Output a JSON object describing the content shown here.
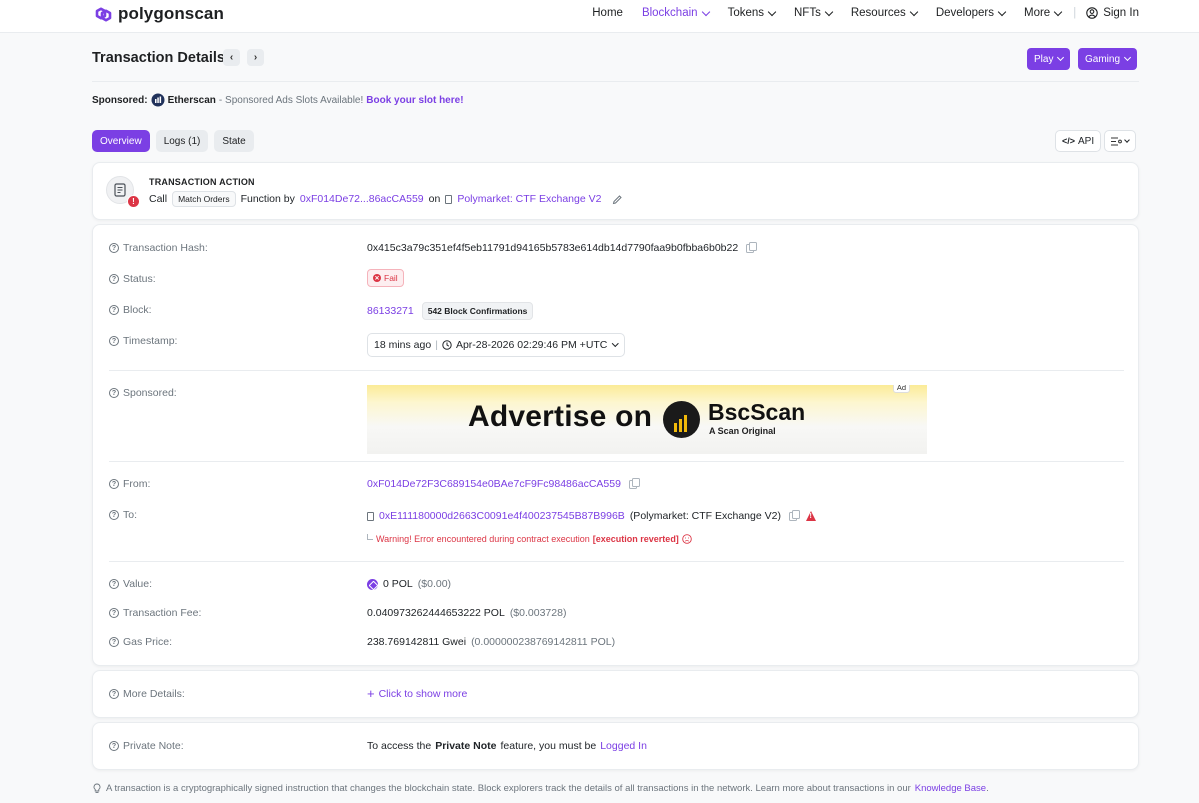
{
  "header": {
    "logo_text": "polygonscan",
    "nav": [
      {
        "label": "Home",
        "active": false,
        "dropdown": false
      },
      {
        "label": "Blockchain",
        "active": true,
        "dropdown": true
      },
      {
        "label": "Tokens",
        "active": false,
        "dropdown": true
      },
      {
        "label": "NFTs",
        "active": false,
        "dropdown": true
      },
      {
        "label": "Resources",
        "active": false,
        "dropdown": true
      },
      {
        "label": "Developers",
        "active": false,
        "dropdown": true
      },
      {
        "label": "More",
        "active": false,
        "dropdown": true
      }
    ],
    "sign_in": "Sign In"
  },
  "page": {
    "title": "Transaction Details",
    "play_label": "Play",
    "gaming_label": "Gaming"
  },
  "sponsor_line": {
    "label": "Sponsored:",
    "brand": "Etherscan",
    "text": "- Sponsored Ads Slots Available!",
    "link": "Book your slot here!"
  },
  "tabs": [
    {
      "label": "Overview",
      "active": true
    },
    {
      "label": "Logs (1)",
      "active": false
    },
    {
      "label": "State",
      "active": false
    }
  ],
  "tools": {
    "api_label": "API"
  },
  "action": {
    "title": "TRANSACTION ACTION",
    "call": "Call",
    "method": "Match Orders",
    "function_by": "Function by",
    "from_short": "0xF014De72...86acCA559",
    "on": "on",
    "contract": "Polymarket: CTF Exchange V2"
  },
  "details": {
    "tx_hash_label": "Transaction Hash:",
    "tx_hash": "0x415c3a79c351ef4f5eb11791d94165b5783e614db14d7790faa9b0fbba6b0b22",
    "status_label": "Status:",
    "status": "Fail",
    "block_label": "Block:",
    "block": "86133271",
    "confirmations": "542 Block Confirmations",
    "timestamp_label": "Timestamp:",
    "timestamp_ago": "18 mins ago",
    "timestamp_sep": "|",
    "timestamp": "Apr-28-2026 02:29:46 PM +UTC",
    "sponsored_label": "Sponsored:",
    "ad": {
      "tag": "Ad",
      "text": "Advertise on",
      "brand": "BscScan",
      "sub": "A Scan Original"
    },
    "from_label": "From:",
    "from": "0xF014De72F3C689154e0BAe7cF9Fc98486acCA559",
    "to_label": "To:",
    "to": "0xE111180000d2663C0091e4f400237545B87B996B",
    "to_name": "(Polymarket: CTF Exchange V2)",
    "warning": "Warning! Error encountered during contract execution",
    "warning_reason": "[execution reverted]",
    "value_label": "Value:",
    "value": "0 POL",
    "value_usd": "($0.00)",
    "fee_label": "Transaction Fee:",
    "fee": "0.040973262444653222 POL",
    "fee_usd": "($0.003728)",
    "gas_label": "Gas Price:",
    "gas": "238.769142811 Gwei",
    "gas_pol": "(0.000000238769142811 POL)"
  },
  "more": {
    "label": "More Details:",
    "link": "Click to show more"
  },
  "note": {
    "label": "Private Note:",
    "text_before": "To access the",
    "feature": "Private Note",
    "text_after": "feature, you must be",
    "link": "Logged In"
  },
  "footer": {
    "text": "A transaction is a cryptographically signed instruction that changes the blockchain state. Block explorers track the details of all transactions in the network. Learn more about transactions in our",
    "link": "Knowledge Base",
    "end": "."
  },
  "colors": {
    "accent": "#7b3fe4",
    "error": "#dc3545"
  }
}
